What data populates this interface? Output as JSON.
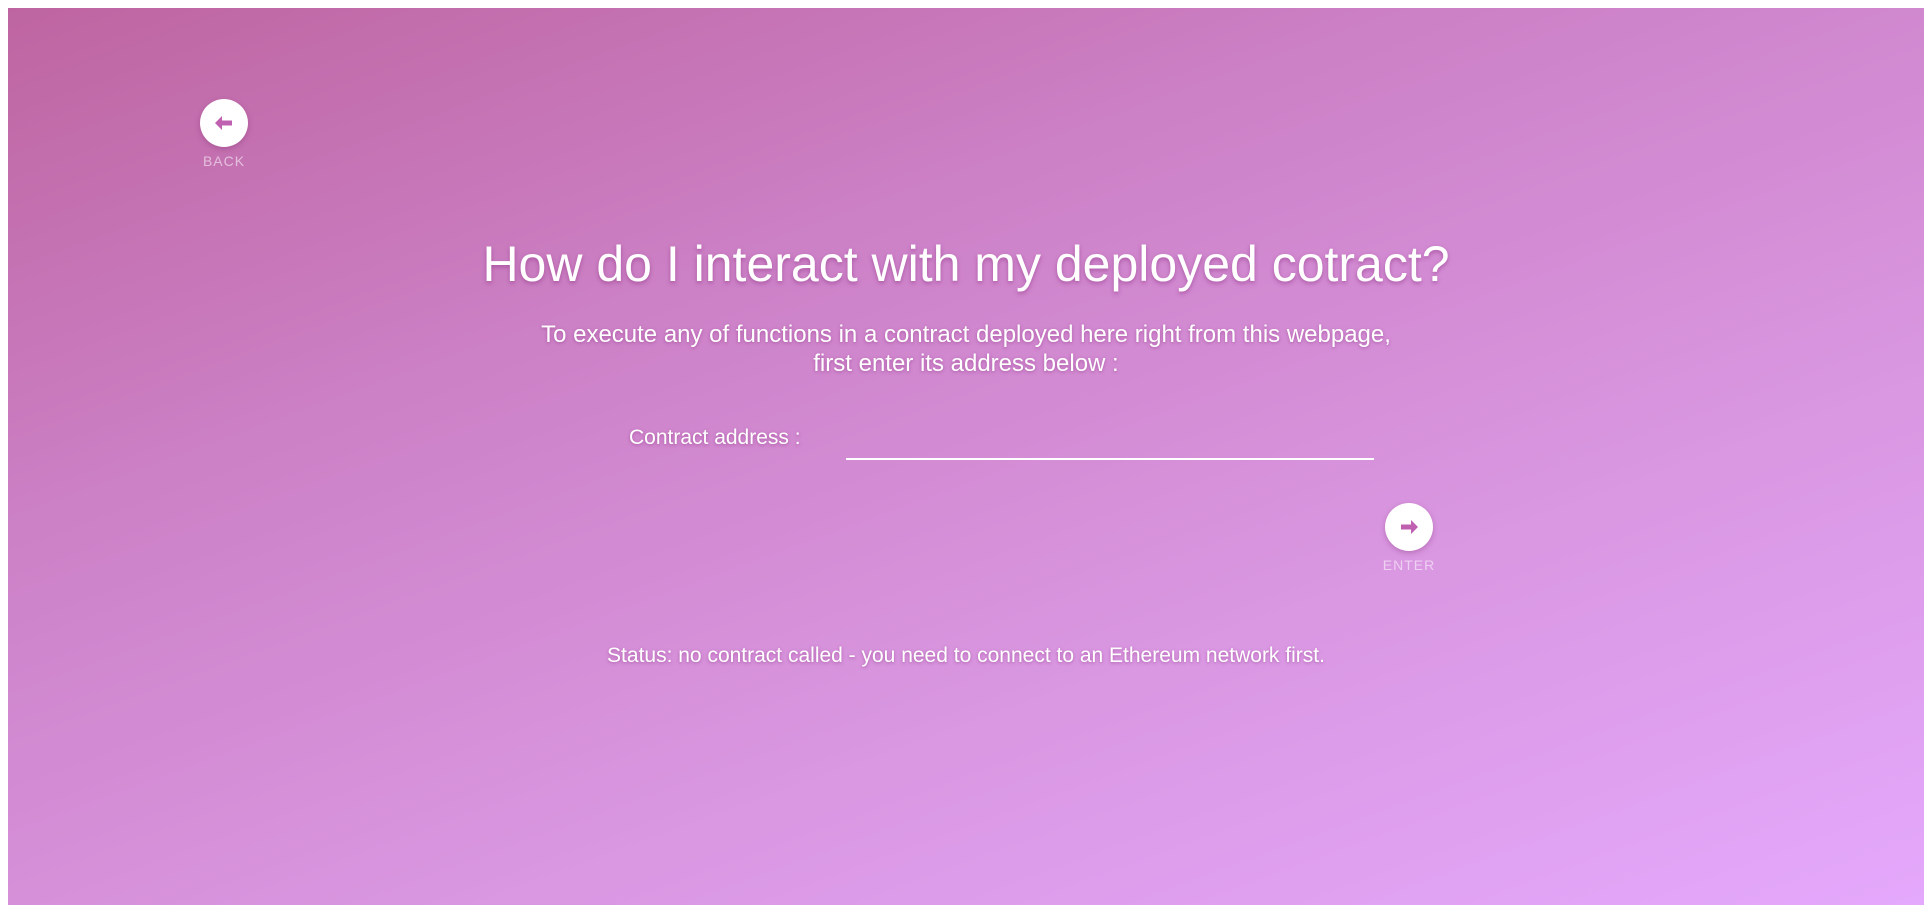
{
  "nav": {
    "back": {
      "icon": "arrow-left-icon",
      "label": "BACK"
    },
    "enter": {
      "icon": "arrow-right-icon",
      "label": "ENTER"
    }
  },
  "page": {
    "title": "How do I interact with my deployed cotract?",
    "subtitle_line1": "To execute any of functions in a contract deployed here right from this webpage,",
    "subtitle_line2": "first enter its address below :"
  },
  "form": {
    "address_label": "Contract address :",
    "address_value": "",
    "address_placeholder": ""
  },
  "status": {
    "text": "Status: no contract called - you need to connect to an Ethereum network first."
  },
  "colors": {
    "accent": "#c060b0",
    "gradient_start": "#be65a1",
    "gradient_end": "#e4a8fc",
    "text": "#ffffff"
  }
}
